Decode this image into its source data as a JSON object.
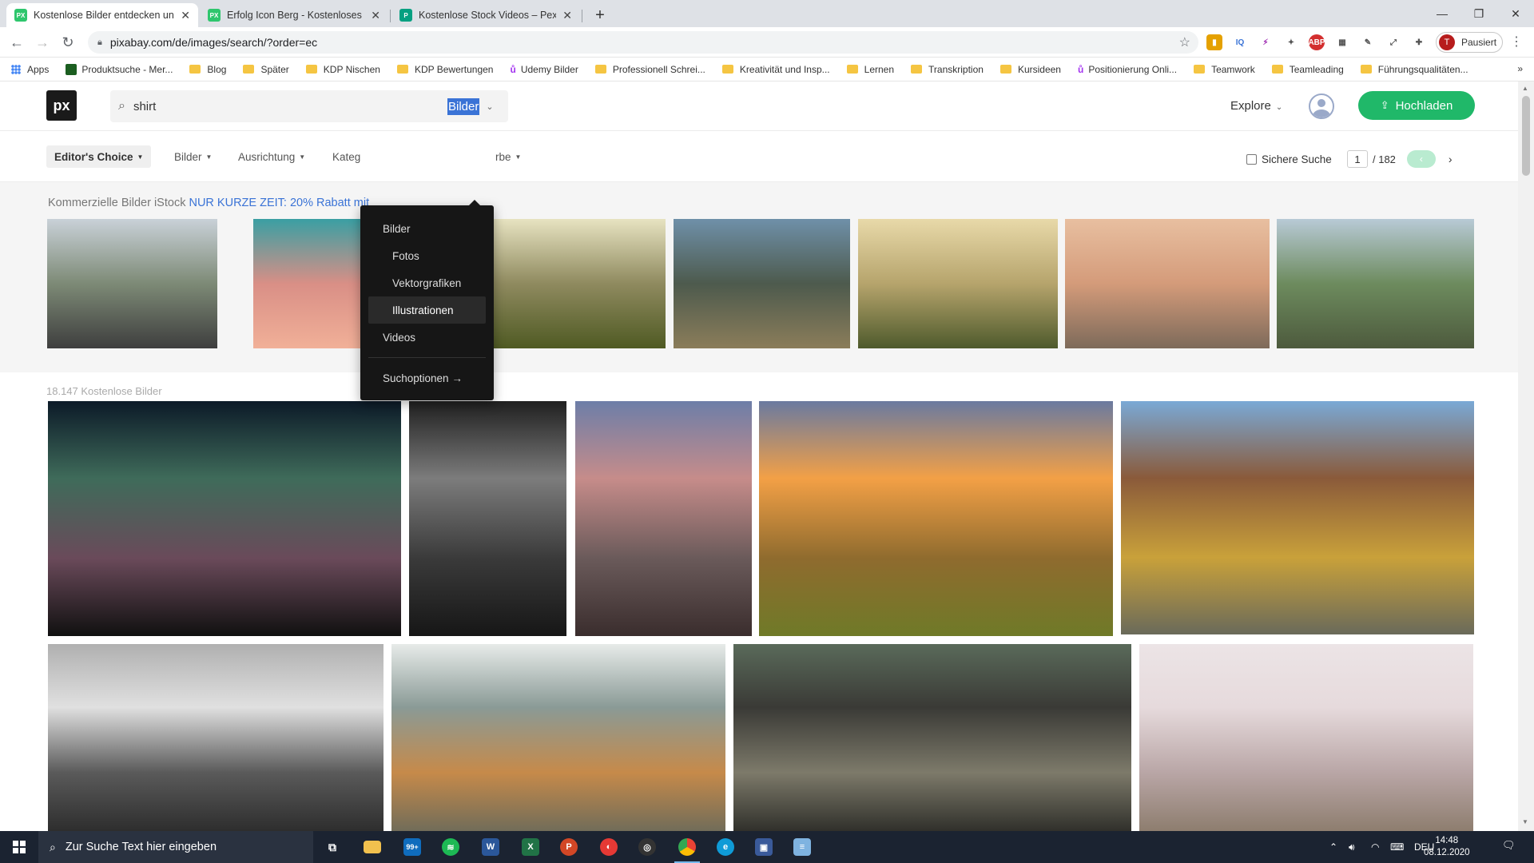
{
  "browser": {
    "tabs": [
      {
        "title": "Kostenlose Bilder entdecken und",
        "favicon": "PX",
        "color": "#2ec66d",
        "active": true
      },
      {
        "title": "Erfolg Icon Berg - Kostenloses Bi",
        "favicon": "PX",
        "color": "#2ec66d",
        "active": false
      },
      {
        "title": "Kostenlose Stock Videos – Pexels",
        "favicon": "P",
        "color": "#05a081",
        "active": false
      }
    ],
    "url": "pixabay.com/de/images/search/?order=ec",
    "profile_status": "Pausiert",
    "profile_initial": "T",
    "bookmarks": [
      {
        "label": "Apps",
        "type": "apps"
      },
      {
        "label": "Produktsuche - Mer...",
        "type": "pk"
      },
      {
        "label": "Blog",
        "type": "folder"
      },
      {
        "label": "Später",
        "type": "folder"
      },
      {
        "label": "KDP Nischen",
        "type": "folder"
      },
      {
        "label": "KDP Bewertungen",
        "type": "folder"
      },
      {
        "label": "Udemy Bilder",
        "type": "udemy"
      },
      {
        "label": "Professionell Schrei...",
        "type": "folder"
      },
      {
        "label": "Kreativität und Insp...",
        "type": "folder"
      },
      {
        "label": "Lernen",
        "type": "folder"
      },
      {
        "label": "Transkription",
        "type": "folder"
      },
      {
        "label": "Kursideen",
        "type": "folder"
      },
      {
        "label": "Positionierung Onli...",
        "type": "udemy"
      },
      {
        "label": "Teamwork",
        "type": "folder"
      },
      {
        "label": "Teamleading",
        "type": "folder"
      },
      {
        "label": "Führungsqualitäten...",
        "type": "folder"
      }
    ]
  },
  "site": {
    "logo": "px",
    "search": {
      "value": "shirt"
    },
    "type_selected": "Bilder",
    "explore": "Explore",
    "upload": "Hochladen",
    "filters": {
      "editors_choice": "Editor's Choice",
      "bilder": "Bilder",
      "ausrichtung": "Ausrichtung",
      "kategorie": "Kateg",
      "farbe": "rbe"
    },
    "safe_search": "Sichere Suche",
    "pager": {
      "current": "1",
      "total": "/ 182",
      "prev": "‹",
      "next": "›"
    },
    "istock": {
      "text": "Kommerzielle Bilder iStock",
      "promo": "NUR KURZE ZEIT: 20% Rabatt mit"
    },
    "count": "18.147 Kostenlose Bilder",
    "dropdown": [
      {
        "label": "Bilder",
        "style": "top"
      },
      {
        "label": "Fotos",
        "style": "indent"
      },
      {
        "label": "Vektorgrafiken",
        "style": "indent"
      },
      {
        "label": "Illustrationen",
        "style": "active"
      },
      {
        "label": "Videos",
        "style": "top"
      },
      {
        "label": "Suchoptionen →",
        "style": "footer"
      }
    ],
    "istock_images": [
      {
        "name": "kid-in-red-car",
        "colors": [
          "#c9d1d8",
          "#7d8a76",
          "#3e3e3e"
        ]
      },
      {
        "name": "pink-sky-tree",
        "colors": [
          "#3a9fa3",
          "#d98f86",
          "#f1b098"
        ]
      },
      {
        "name": "hikers-coast",
        "colors": [
          "#e7e3c1",
          "#8f8a5f",
          "#4f5a23"
        ]
      },
      {
        "name": "climber-cliff",
        "colors": [
          "#6f90a9",
          "#4d5a4d",
          "#8b7d5a"
        ]
      },
      {
        "name": "couple-hiking",
        "colors": [
          "#e8d9a9",
          "#b6a46c",
          "#4e5a2c"
        ]
      },
      {
        "name": "hands-holding",
        "colors": [
          "#e8bfa0",
          "#d49b7a",
          "#7d6a5a"
        ]
      },
      {
        "name": "couple-sitting-mountains",
        "colors": [
          "#b8cad6",
          "#6d8b5e",
          "#4d5a3d"
        ]
      }
    ],
    "gallery_images": [
      {
        "name": "aurora-photographer",
        "colors": [
          "#0c1a28",
          "#3f6b5a",
          "#6a4a5a",
          "#101010"
        ]
      },
      {
        "name": "cathedral-alley",
        "colors": [
          "#202020",
          "#7c7c7c",
          "#3a3a3a",
          "#161616"
        ]
      },
      {
        "name": "prague-bridge",
        "colors": [
          "#6d7ea8",
          "#c68c8a",
          "#6a5a5a",
          "#3a2d2d"
        ]
      },
      {
        "name": "sunset-valley",
        "colors": [
          "#6a7aa0",
          "#f3a046",
          "#8f6b2e",
          "#6f7a28"
        ]
      },
      {
        "name": "hoi-an-street",
        "colors": [
          "#7aa9d6",
          "#8a5a3a",
          "#c9a13a",
          "#6a6a5a"
        ]
      },
      {
        "name": "cliff-bw",
        "colors": [
          "#b0b0b0",
          "#e0e0e0",
          "#5a5a5a",
          "#2a2a2a"
        ]
      },
      {
        "name": "frost-branches",
        "colors": [
          "#e7ebe9",
          "#8a9a96",
          "#c68a4a",
          "#6a6a5a"
        ]
      },
      {
        "name": "sea-lion",
        "colors": [
          "#5a6a5a",
          "#3a3a36",
          "#7d7a6a",
          "#2a2a26"
        ]
      },
      {
        "name": "giraffe-savanna",
        "colors": [
          "#ece4e6",
          "#e6dadc",
          "#b9a6a6",
          "#8a7a6a"
        ]
      }
    ]
  },
  "taskbar": {
    "search_placeholder": "Zur Suche Text hier eingeben",
    "mail_badge": "99+",
    "language": "DEU",
    "time": "14:48",
    "date": "08.12.2020"
  }
}
